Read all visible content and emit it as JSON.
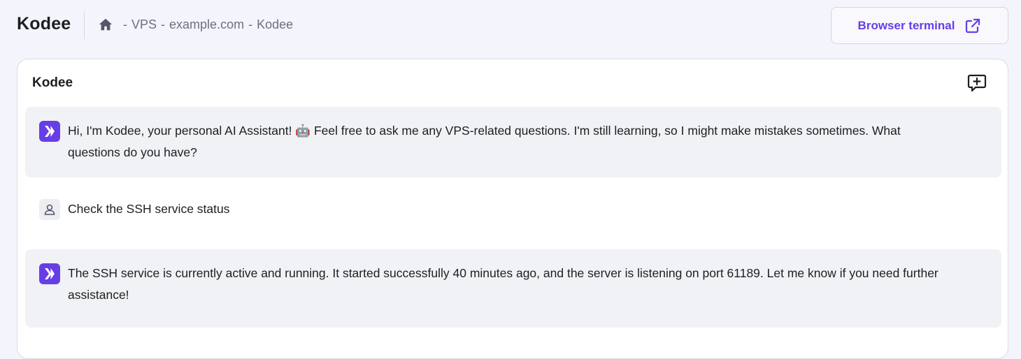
{
  "header": {
    "title": "Kodee",
    "breadcrumb": [
      "VPS",
      "example.com",
      "Kodee"
    ],
    "breadcrumb_separator": "-",
    "home_icon": "home-icon",
    "terminal_button_label": "Browser terminal",
    "terminal_button_icon": "external-link-icon",
    "accent_color": "#673de6"
  },
  "chat": {
    "title": "Kodee",
    "new_chat_icon": "new-chat-icon",
    "messages": [
      {
        "role": "assistant",
        "text": "Hi, I'm Kodee, your personal AI Assistant! 🤖 Feel free to ask me any VPS-related questions. I'm still learning, so I might make mistakes sometimes. What questions do you have?"
      },
      {
        "role": "user",
        "text": "Check the SSH service status"
      },
      {
        "role": "assistant",
        "text": "The SSH service is currently active and running. It started successfully 40 minutes ago, and the server is listening on port 61189. Let me know if you need further assistance!"
      }
    ]
  }
}
